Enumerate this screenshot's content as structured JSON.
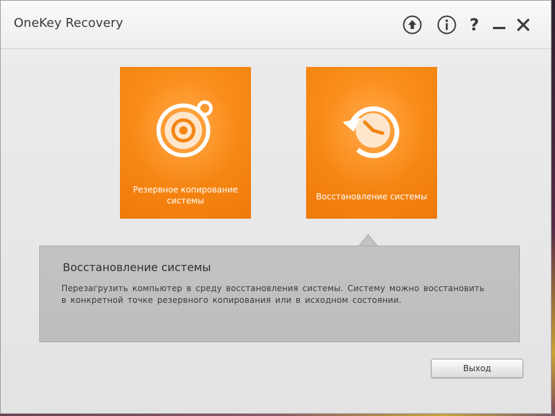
{
  "window": {
    "title": "OneKey Recovery"
  },
  "controls": {
    "upload_icon": "upload-icon",
    "info_icon": "info-icon",
    "help_label": "?",
    "minimize_icon": "minimize-icon",
    "close_icon": "close-icon"
  },
  "tiles": [
    {
      "icon": "disc-backup-icon",
      "label": "Резервное копирование системы"
    },
    {
      "icon": "clock-restore-icon",
      "label": "Восстановление системы"
    }
  ],
  "description": {
    "title": "Восстановление системы",
    "text": "Перезагрузить компьютер в среду восстановления системы. Систему можно восстановить в конкретной точке резервного копирования или в исходном состоянии."
  },
  "buttons": {
    "exit_label": "Выход"
  },
  "colors": {
    "tile_orange": "#f98a15",
    "panel_gray": "#c0c0c0"
  }
}
